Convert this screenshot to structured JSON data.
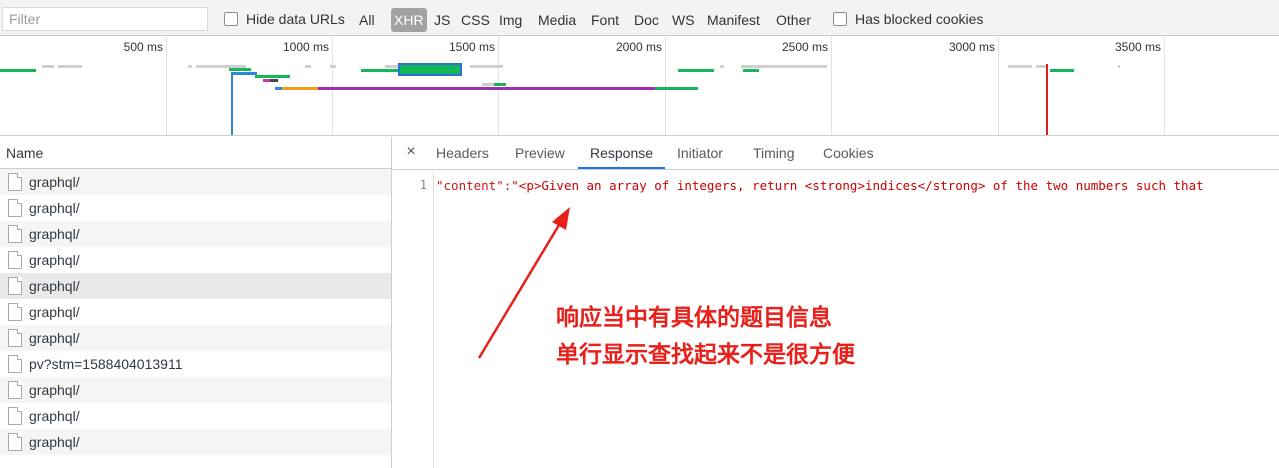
{
  "toolbar": {
    "filter_placeholder": "Filter",
    "hide_data_urls": "Hide data URLs",
    "types": [
      "All",
      "XHR",
      "JS",
      "CSS",
      "Img",
      "Media",
      "Font",
      "Doc",
      "WS",
      "Manifest",
      "Other"
    ],
    "active_type": "XHR",
    "has_blocked_cookies": "Has blocked cookies"
  },
  "overview": {
    "ticks": [
      "500 ms",
      "1000 ms",
      "1500 ms",
      "2000 ms",
      "2500 ms",
      "3000 ms",
      "3500 ms"
    ]
  },
  "list": {
    "header": "Name",
    "rows": [
      "graphql/",
      "graphql/",
      "graphql/",
      "graphql/",
      "graphql/",
      "graphql/",
      "graphql/",
      "pv?stm=1588404013911",
      "graphql/",
      "graphql/",
      "graphql/"
    ],
    "selected_index": 4
  },
  "detail": {
    "close": "×",
    "tabs": [
      "Headers",
      "Preview",
      "Response",
      "Initiator",
      "Timing",
      "Cookies"
    ],
    "active_tab": "Response",
    "line_number": "1",
    "code_key": "\"content\":",
    "code_value": "\"<p>Given an array of integers, return <strong>indices</strong> of the two numbers such that"
  },
  "annotation": {
    "line1": "响应当中有具体的题目信息",
    "line2": "单行显示查找起来不是很方便",
    "color": "#e8201a"
  }
}
